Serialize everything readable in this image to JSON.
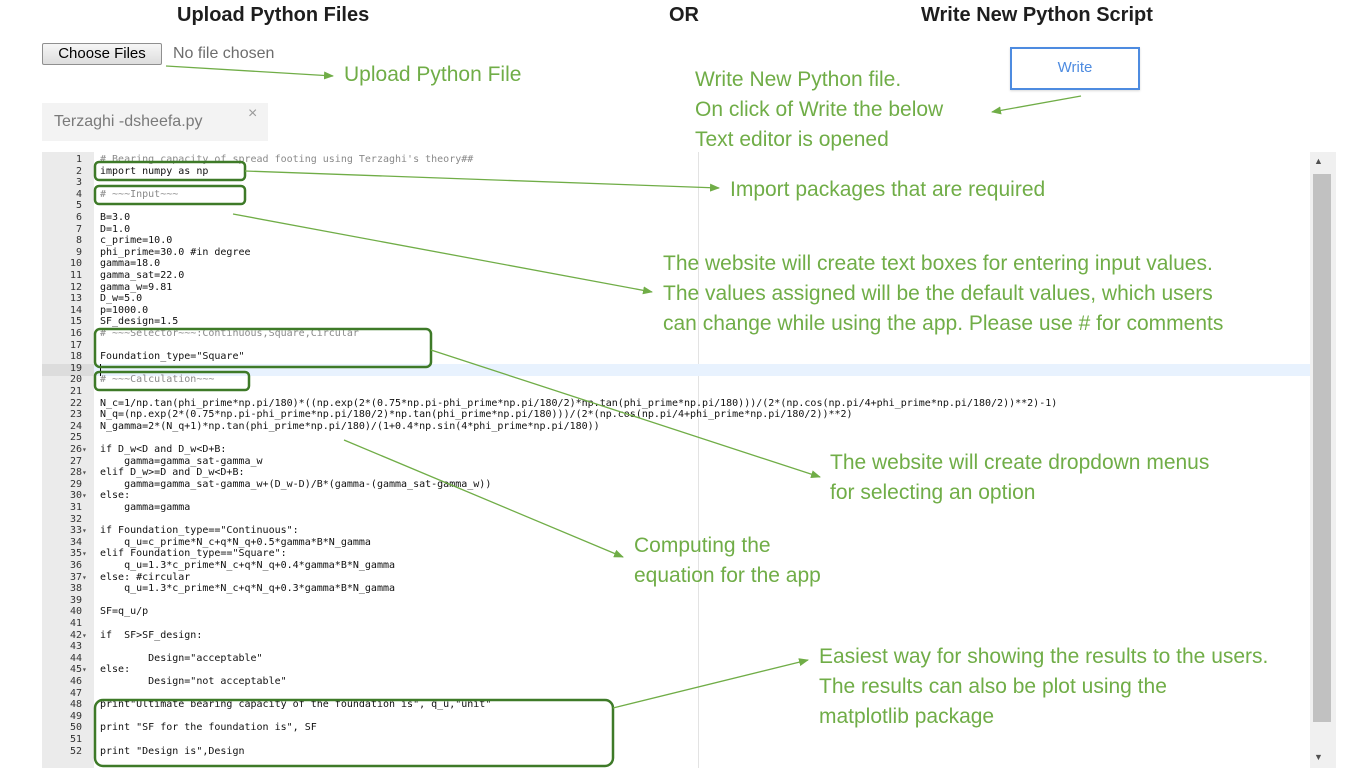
{
  "header": {
    "upload_title": "Upload Python Files",
    "or_label": "OR",
    "write_title": "Write New Python Script"
  },
  "upload": {
    "choose_label": "Choose Files",
    "no_file_label": "No file chosen"
  },
  "write_button_label": "Write",
  "tab": {
    "filename": "Terzaghi -dsheefa.py",
    "close_glyph": "×"
  },
  "editor": {
    "lines": [
      {
        "n": "1",
        "fold": "",
        "text": "# Bearing capacity of spread footing using Terzaghi's theory##"
      },
      {
        "n": "2",
        "fold": "",
        "text": "import numpy as np"
      },
      {
        "n": "3",
        "fold": "",
        "text": ""
      },
      {
        "n": "4",
        "fold": "",
        "text": "# ~~~Input~~~"
      },
      {
        "n": "5",
        "fold": "",
        "text": ""
      },
      {
        "n": "6",
        "fold": "",
        "text": "B=3.0"
      },
      {
        "n": "7",
        "fold": "",
        "text": "D=1.0"
      },
      {
        "n": "8",
        "fold": "",
        "text": "c_prime=10.0"
      },
      {
        "n": "9",
        "fold": "",
        "text": "phi_prime=30.0 #in degree"
      },
      {
        "n": "10",
        "fold": "",
        "text": "gamma=18.0"
      },
      {
        "n": "11",
        "fold": "",
        "text": "gamma_sat=22.0"
      },
      {
        "n": "12",
        "fold": "",
        "text": "gamma_w=9.81"
      },
      {
        "n": "13",
        "fold": "",
        "text": "D_w=5.0"
      },
      {
        "n": "14",
        "fold": "",
        "text": "p=1000.0"
      },
      {
        "n": "15",
        "fold": "",
        "text": "SF_design=1.5"
      },
      {
        "n": "16",
        "fold": "",
        "text": "# ~~~Selector~~~:Continuous,Square,Circular"
      },
      {
        "n": "17",
        "fold": "",
        "text": ""
      },
      {
        "n": "18",
        "fold": "",
        "text": "Foundation_type=\"Square\""
      },
      {
        "n": "19",
        "fold": "",
        "text": ""
      },
      {
        "n": "20",
        "fold": "",
        "text": "# ~~~Calculation~~~"
      },
      {
        "n": "21",
        "fold": "",
        "text": ""
      },
      {
        "n": "22",
        "fold": "",
        "text": "N_c=1/np.tan(phi_prime*np.pi/180)*((np.exp(2*(0.75*np.pi-phi_prime*np.pi/180/2)*np.tan(phi_prime*np.pi/180)))/(2*(np.cos(np.pi/4+phi_prime*np.pi/180/2))**2)-1)"
      },
      {
        "n": "23",
        "fold": "",
        "text": "N_q=(np.exp(2*(0.75*np.pi-phi_prime*np.pi/180/2)*np.tan(phi_prime*np.pi/180)))/(2*(np.cos(np.pi/4+phi_prime*np.pi/180/2))**2)"
      },
      {
        "n": "24",
        "fold": "",
        "text": "N_gamma=2*(N_q+1)*np.tan(phi_prime*np.pi/180)/(1+0.4*np.sin(4*phi_prime*np.pi/180))"
      },
      {
        "n": "25",
        "fold": "",
        "text": ""
      },
      {
        "n": "26",
        "fold": "▾",
        "text": "if D_w<D and D_w<D+B:"
      },
      {
        "n": "27",
        "fold": "",
        "text": "    gamma=gamma_sat-gamma_w"
      },
      {
        "n": "28",
        "fold": "▾",
        "text": "elif D_w>=D and D_w<D+B:"
      },
      {
        "n": "29",
        "fold": "",
        "text": "    gamma=gamma_sat-gamma_w+(D_w-D)/B*(gamma-(gamma_sat-gamma_w))"
      },
      {
        "n": "30",
        "fold": "▾",
        "text": "else:"
      },
      {
        "n": "31",
        "fold": "",
        "text": "    gamma=gamma"
      },
      {
        "n": "32",
        "fold": "",
        "text": ""
      },
      {
        "n": "33",
        "fold": "▾",
        "text": "if Foundation_type==\"Continuous\":"
      },
      {
        "n": "34",
        "fold": "",
        "text": "    q_u=c_prime*N_c+q*N_q+0.5*gamma*B*N_gamma"
      },
      {
        "n": "35",
        "fold": "▾",
        "text": "elif Foundation_type==\"Square\":"
      },
      {
        "n": "36",
        "fold": "",
        "text": "    q_u=1.3*c_prime*N_c+q*N_q+0.4*gamma*B*N_gamma"
      },
      {
        "n": "37",
        "fold": "▾",
        "text": "else: #circular"
      },
      {
        "n": "38",
        "fold": "",
        "text": "    q_u=1.3*c_prime*N_c+q*N_q+0.3*gamma*B*N_gamma"
      },
      {
        "n": "39",
        "fold": "",
        "text": ""
      },
      {
        "n": "40",
        "fold": "",
        "text": "SF=q_u/p"
      },
      {
        "n": "41",
        "fold": "",
        "text": ""
      },
      {
        "n": "42",
        "fold": "▾",
        "text": "if  SF>SF_design:"
      },
      {
        "n": "43",
        "fold": "",
        "text": ""
      },
      {
        "n": "44",
        "fold": "",
        "text": "        Design=\"acceptable\""
      },
      {
        "n": "45",
        "fold": "▾",
        "text": "else:"
      },
      {
        "n": "46",
        "fold": "",
        "text": "        Design=\"not acceptable\""
      },
      {
        "n": "47",
        "fold": "",
        "text": ""
      },
      {
        "n": "48",
        "fold": "",
        "text": "print\"Ultimate bearing capacity of the foundation is\", q_u,\"unit\""
      },
      {
        "n": "49",
        "fold": "",
        "text": ""
      },
      {
        "n": "50",
        "fold": "",
        "text": "print \"SF for the foundation is\", SF"
      },
      {
        "n": "51",
        "fold": "",
        "text": ""
      },
      {
        "n": "52",
        "fold": "",
        "text": "print \"Design is\",Design"
      }
    ]
  },
  "annotations": {
    "upload_note": "Upload Python File",
    "write_note": [
      "Write New Python file.",
      "On click of Write the below",
      "Text editor is opened"
    ],
    "import_note": "Import packages that are required",
    "input_note": [
      "The website will create text boxes for entering input values.",
      "The values assigned will be the default values, which users",
      "can change while  using the app. Please use # for comments"
    ],
    "dropdown_note": [
      "The website will create dropdown menus",
      "for selecting an option"
    ],
    "compute_note": [
      "Computing the",
      "equation for the app"
    ],
    "results_note": [
      "Easiest way for showing the results to the users.",
      "The results  can also be plot using the",
      "matplotlib package"
    ]
  },
  "colors": {
    "annotation_green": "#70ad47",
    "box_green": "#3e7a28",
    "write_blue": "#4d8be0"
  },
  "icons": {
    "fold": "chevron-down-icon",
    "close": "close-icon",
    "scroll_up": "arrow-up-icon",
    "scroll_down": "arrow-down-icon"
  }
}
